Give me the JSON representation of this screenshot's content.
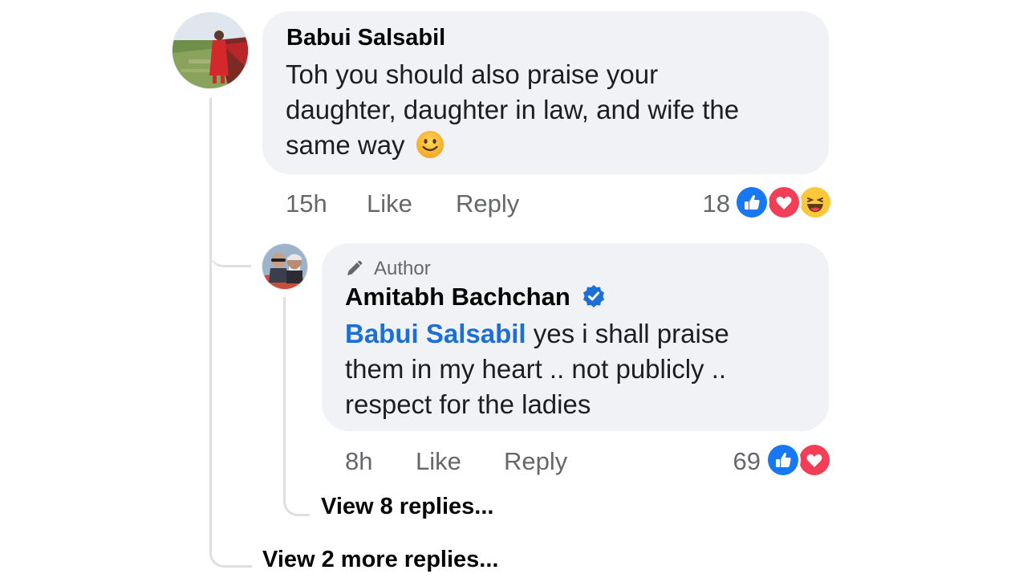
{
  "comment": {
    "author": "Babui Salsabil",
    "text_lines": [
      "Toh you should also praise your",
      "daughter, daughter in law, and wife the",
      "same way"
    ],
    "emoji": "🙂",
    "time": "15h",
    "like_label": "Like",
    "reply_label": "Reply",
    "reaction_count": "18",
    "reactions": [
      "like-icon",
      "love-icon",
      "haha-icon"
    ]
  },
  "reply": {
    "badge": "Author",
    "author": "Amitabh Bachchan",
    "verified": "verified-badge-icon",
    "mention": "Babui Salsabil",
    "text_first": " yes i shall praise",
    "text_lines": [
      "them in my heart .. not publicly ..",
      "respect for the ladies"
    ],
    "time": "8h",
    "like_label": "Like",
    "reply_label": "Reply",
    "reaction_count": "69",
    "reactions": [
      "like-icon",
      "love-icon"
    ]
  },
  "view_replies_inner": "View 8 replies...",
  "view_replies_outer": "View 2 more replies...",
  "colors": {
    "bubble": "#f0f2f5",
    "meta": "#65676b",
    "mention": "#1b6fd6",
    "like_blue": "#1877f2",
    "love_red": "#f33e58",
    "haha_yellow": "#fcc83a",
    "thread_line": "#dcdfe3"
  }
}
